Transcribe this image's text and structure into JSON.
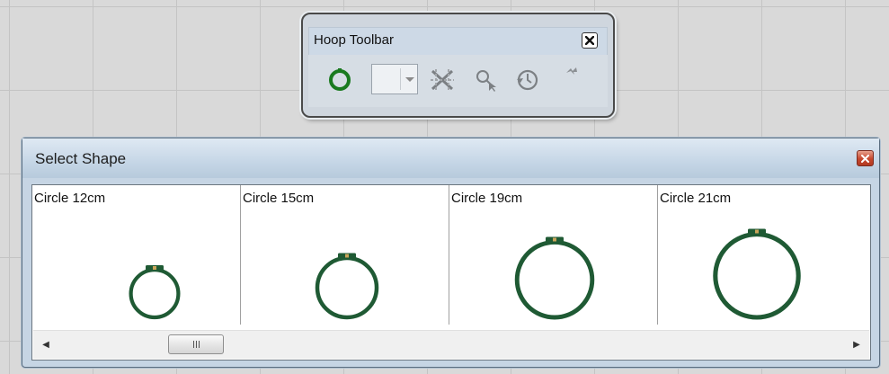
{
  "hoop_toolbar": {
    "title": "Hoop Toolbar",
    "buttons": [
      {
        "icon": "green-hoop-icon"
      },
      {
        "icon": "hoop-combo-dropdown"
      },
      {
        "icon": "crossed-stitch-icon"
      },
      {
        "icon": "magnifier-pointer-icon"
      },
      {
        "icon": "clock-arrow-icon"
      },
      {
        "icon": "small-arrow-icon"
      }
    ]
  },
  "select_shape": {
    "title": "Select Shape",
    "shapes": [
      {
        "label": "Circle 12cm",
        "size_cm": 12
      },
      {
        "label": "Circle 15cm",
        "size_cm": 15
      },
      {
        "label": "Circle 19cm",
        "size_cm": 19
      },
      {
        "label": "Circle 21cm",
        "size_cm": 21
      }
    ],
    "scrollbar": {
      "position": 0.15
    }
  },
  "colors": {
    "hoop_green": "#1f5a34",
    "close_red": "#c6472d"
  }
}
